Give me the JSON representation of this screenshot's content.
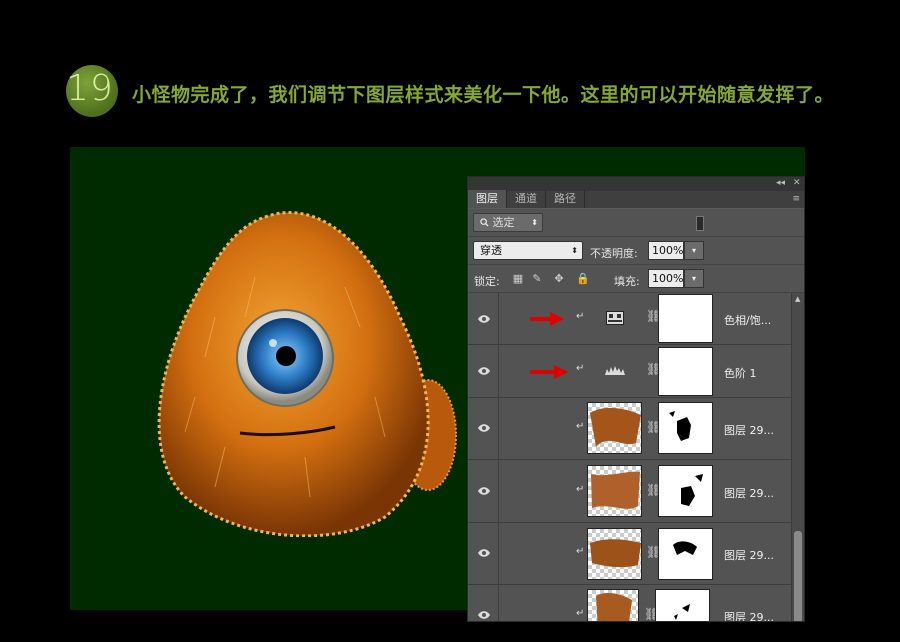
{
  "header": {
    "step_number": "19",
    "text": "小怪物完成了，我们调节下图层样式来美化一下他。这里的可以开始随意发挥了。"
  },
  "colors": {
    "accent_green": "#84a735",
    "canvas_bg": "#002b00",
    "panel_bg": "#535353",
    "arrow_red": "#e00000"
  },
  "panel": {
    "window_controls": {
      "collapse": "◂◂",
      "close": "✕"
    },
    "tabs": [
      {
        "label": "图层",
        "active": true
      },
      {
        "label": "通道",
        "active": false
      },
      {
        "label": "路径",
        "active": false
      }
    ],
    "menu_icon": "≡",
    "filter": {
      "label": "选定",
      "icon": "search-icon"
    },
    "blend_mode": "穿透",
    "opacity_label": "不透明度:",
    "opacity_value": "100%",
    "lock_label": "锁定:",
    "fill_label": "填充:",
    "fill_value": "100%",
    "layers": [
      {
        "name": "色相/饱...",
        "kind": "hue-saturation-adjustment",
        "arrow": true
      },
      {
        "name": "色阶 1",
        "kind": "levels-adjustment",
        "arrow": true
      },
      {
        "name": "图层 29...",
        "kind": "fur-layer"
      },
      {
        "name": "图层 29...",
        "kind": "fur-layer"
      },
      {
        "name": "图层 29...",
        "kind": "fur-layer"
      },
      {
        "name": "图层 29...",
        "kind": "fur-layer"
      }
    ]
  }
}
